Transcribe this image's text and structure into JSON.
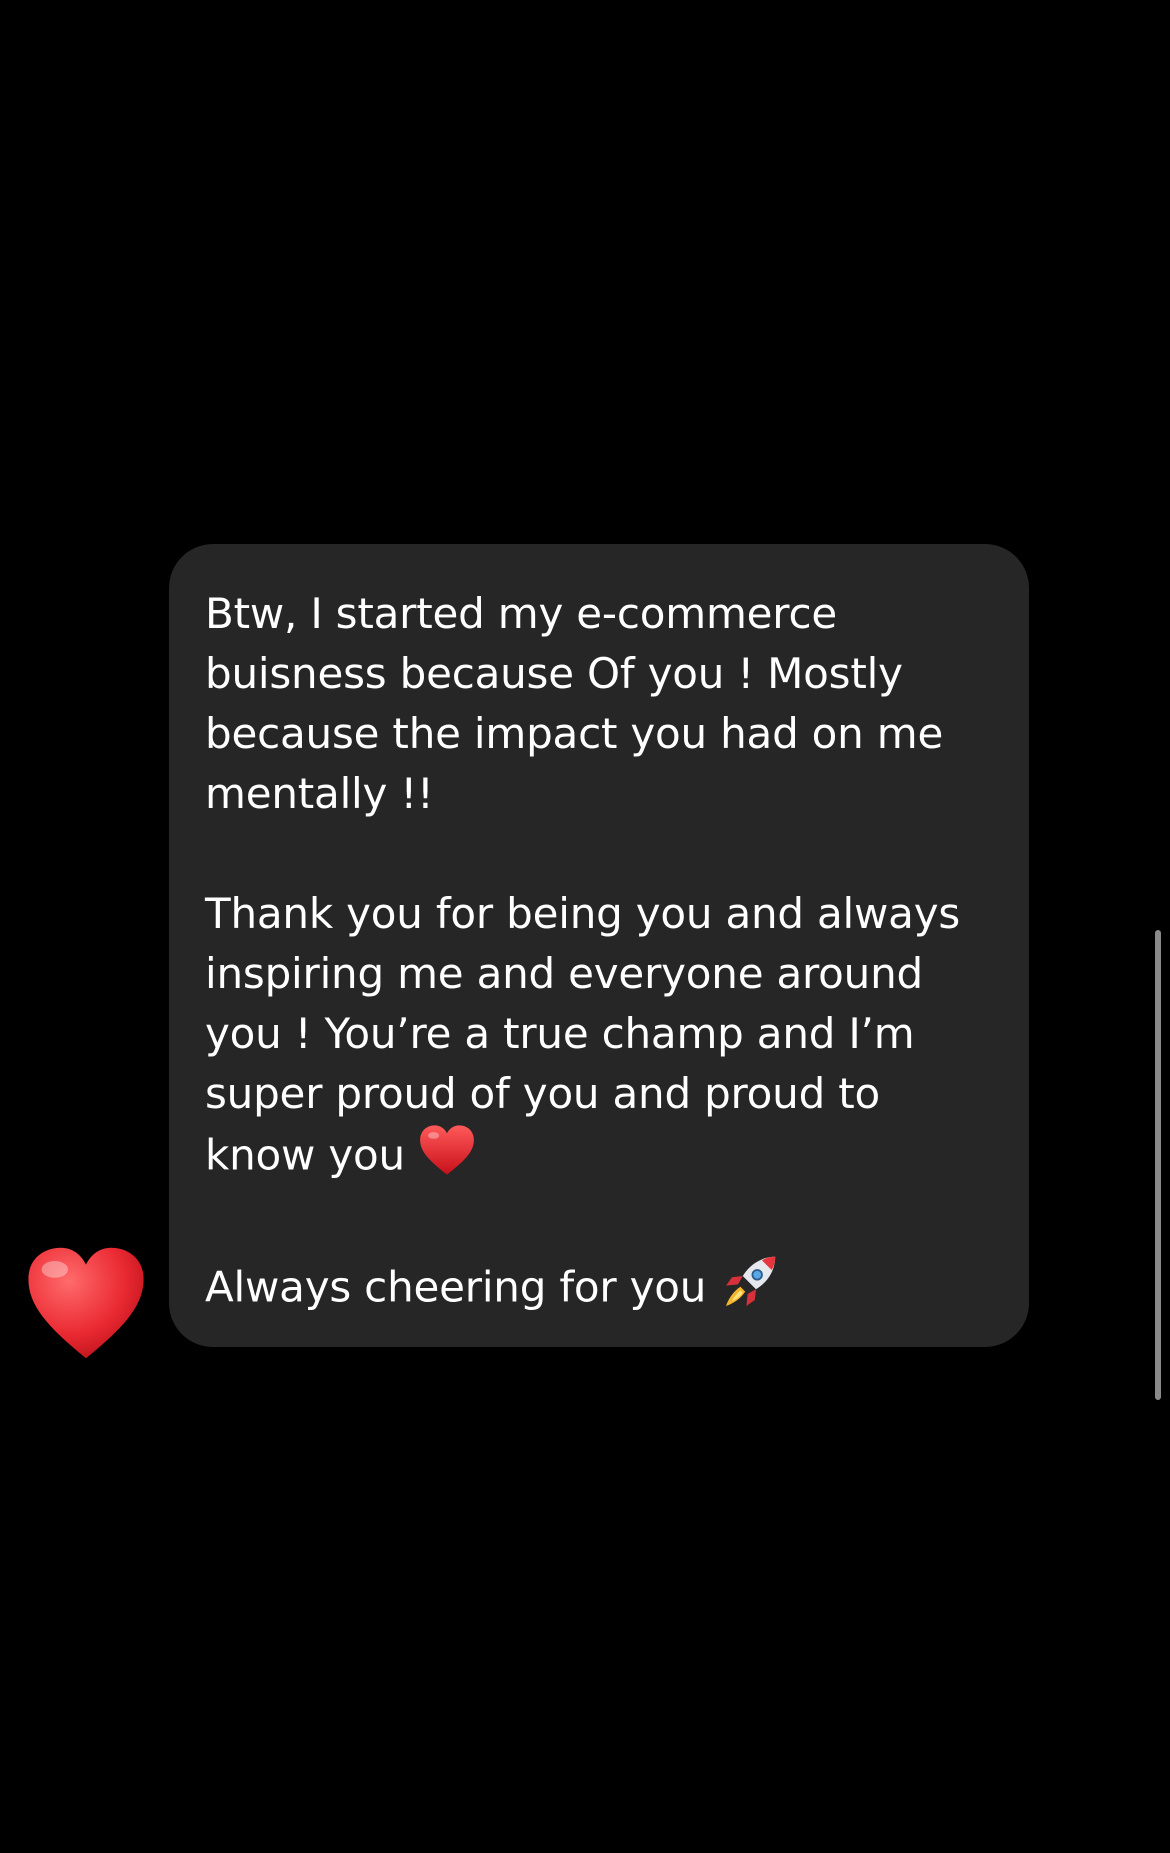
{
  "message": {
    "paragraph_1": "Btw, I started my e-commerce\nbuisness because Of you ! Mostly\nbecause the impact you had on me\nmentally !!",
    "paragraph_2": "Thank you for being you and always\ninspiring me and everyone around\nyou ! You’re a true champ and I’m\nsuper proud of you and proud to\nknow you",
    "paragraph_3": "Always cheering for you",
    "inline_emoji_2": "heart-icon",
    "inline_emoji_3": "rocket-icon"
  },
  "reaction": {
    "icon": "heart-icon",
    "color": "#e8232c"
  },
  "colors": {
    "background": "#000000",
    "bubble": "#262626",
    "text": "#ffffff",
    "scrollbar": "#8a8a8a"
  }
}
